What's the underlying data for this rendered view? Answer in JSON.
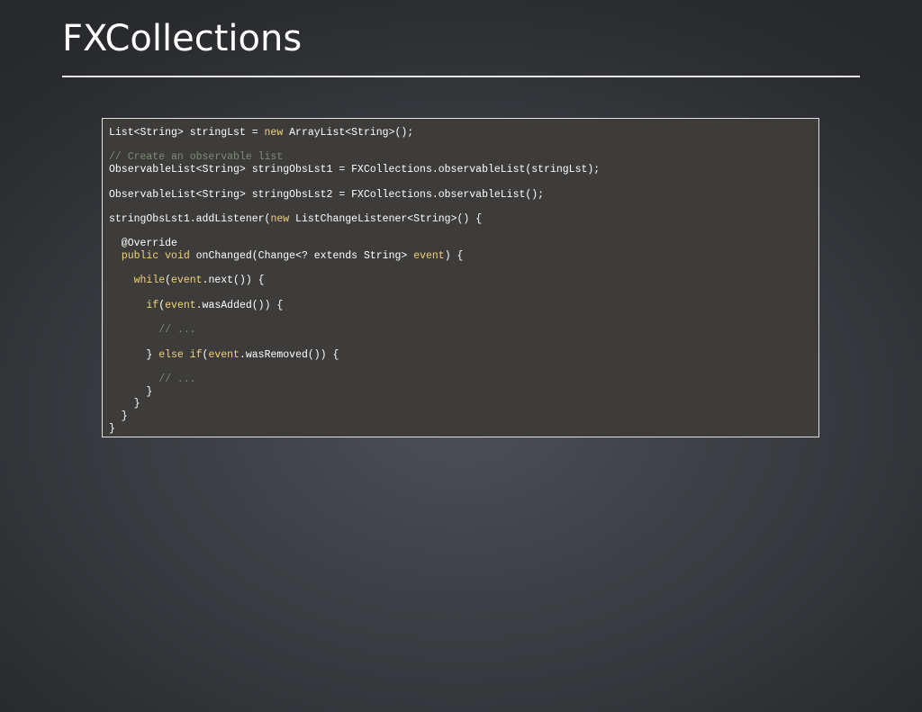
{
  "slide": {
    "title": "FXCollections"
  },
  "colors": {
    "plain": "#ffffff",
    "keyword": "#f0d37a",
    "comment": "#7c8b76",
    "code_background": "#3d3c3b",
    "border": "#e0e0e0"
  },
  "code": {
    "lines": [
      [
        {
          "t": "List<String> stringLst = ",
          "k": "plain"
        },
        {
          "t": "new",
          "k": "kw"
        },
        {
          "t": " ArrayList<String>();",
          "k": "plain"
        }
      ],
      [],
      [
        {
          "t": "// Create an observable list",
          "k": "comment"
        }
      ],
      [
        {
          "t": "ObservableList<String> stringObsLst1 = FXCollections.observableList(stringLst);",
          "k": "plain"
        }
      ],
      [],
      [
        {
          "t": "ObservableList<String> stringObsLst2 = FXCollections.observableList();",
          "k": "plain"
        }
      ],
      [],
      [
        {
          "t": "stringObsLst1.addListener(",
          "k": "plain"
        },
        {
          "t": "new",
          "k": "kw"
        },
        {
          "t": " ListChangeListener<String>() {",
          "k": "plain"
        }
      ],
      [],
      [
        {
          "t": "  @Override",
          "k": "plain"
        }
      ],
      [
        {
          "t": "  ",
          "k": "plain"
        },
        {
          "t": "public",
          "k": "kw"
        },
        {
          "t": " ",
          "k": "plain"
        },
        {
          "t": "void",
          "k": "kw"
        },
        {
          "t": " onChanged(Change<? extends String> ",
          "k": "plain"
        },
        {
          "t": "event",
          "k": "kw"
        },
        {
          "t": ") {",
          "k": "plain"
        }
      ],
      [],
      [
        {
          "t": "    ",
          "k": "plain"
        },
        {
          "t": "while",
          "k": "kw"
        },
        {
          "t": "(",
          "k": "plain"
        },
        {
          "t": "event",
          "k": "kw"
        },
        {
          "t": ".next()) {",
          "k": "plain"
        }
      ],
      [],
      [
        {
          "t": "      ",
          "k": "plain"
        },
        {
          "t": "if",
          "k": "kw"
        },
        {
          "t": "(",
          "k": "plain"
        },
        {
          "t": "event",
          "k": "kw"
        },
        {
          "t": ".wasAdded()) {",
          "k": "plain"
        }
      ],
      [],
      [
        {
          "t": "        // ...",
          "k": "comment"
        }
      ],
      [],
      [
        {
          "t": "      } ",
          "k": "plain"
        },
        {
          "t": "else",
          "k": "kw"
        },
        {
          "t": " ",
          "k": "plain"
        },
        {
          "t": "if",
          "k": "kw"
        },
        {
          "t": "(",
          "k": "plain"
        },
        {
          "t": "event",
          "k": "kw"
        },
        {
          "t": ".wasRemoved()) {",
          "k": "plain"
        }
      ],
      [],
      [
        {
          "t": "        // ...",
          "k": "comment"
        }
      ],
      [
        {
          "t": "      }",
          "k": "plain"
        }
      ],
      [
        {
          "t": "    }",
          "k": "plain"
        }
      ],
      [
        {
          "t": "  }",
          "k": "plain"
        }
      ],
      [
        {
          "t": "}",
          "k": "plain"
        }
      ]
    ]
  }
}
